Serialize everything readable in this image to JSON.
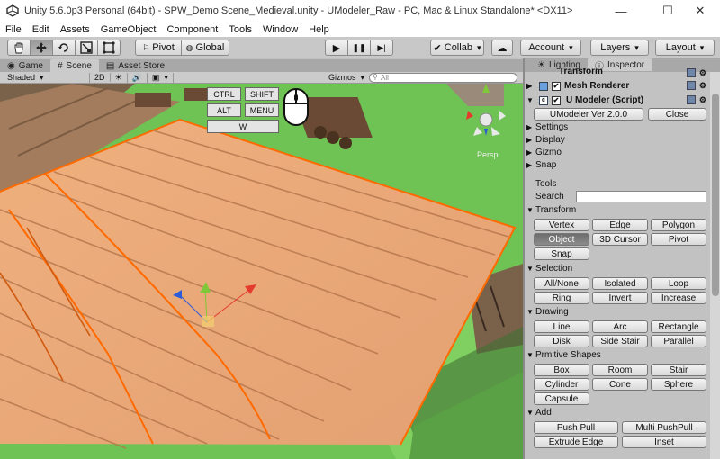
{
  "window": {
    "title": "Unity 5.6.0p3 Personal (64bit) - SPW_Demo Scene_Medieval.unity - UModeler_Raw - PC, Mac & Linux Standalone* <DX11>",
    "controls": [
      "—",
      "☐",
      "✕"
    ]
  },
  "menu": [
    "File",
    "Edit",
    "Assets",
    "GameObject",
    "Component",
    "Tools",
    "Window",
    "Help"
  ],
  "toolbar": {
    "tools": [
      "hand-icon",
      "move-icon",
      "rotate-icon",
      "scale-icon",
      "rect-icon"
    ],
    "pivot": "Pivot",
    "global": "Global",
    "play": [
      "▶",
      "❚❚",
      "▶|"
    ],
    "collab": "Collab",
    "account": "Account",
    "layers": "Layers",
    "layout": "Layout"
  },
  "tabs": {
    "game": "Game",
    "scene": "Scene",
    "asset_store": "Asset Store"
  },
  "scenebar": {
    "shading": "Shaded",
    "mode2d": "2D",
    "gizmos": "Gizmos",
    "search_placeholder": "All"
  },
  "overlay": {
    "keys": [
      "CTRL",
      "SHIFT",
      "ALT",
      "MENU",
      "W"
    ],
    "persp": "Persp"
  },
  "inspector": {
    "tabs": {
      "lighting": "Lighting",
      "inspector": "Inspector"
    },
    "components": [
      "Transform",
      "Mesh Renderer",
      "U Modeler (Script)"
    ],
    "version_button": "UModeler Ver 2.0.0",
    "close_button": "Close",
    "foldouts": [
      "Settings",
      "Display",
      "Gizmo",
      "Snap"
    ],
    "tools_label": "Tools",
    "search_label": "Search",
    "transform_label": "Transform",
    "transform_buttons": [
      "Vertex",
      "Edge",
      "Polygon",
      "Object",
      "3D Cursor",
      "Pivot",
      "Snap"
    ],
    "selection_label": "Selection",
    "selection_buttons": [
      "All/None",
      "Isolated",
      "Loop",
      "Ring",
      "Invert",
      "Increase"
    ],
    "drawing_label": "Drawing",
    "drawing_buttons": [
      "Line",
      "Arc",
      "Rectangle",
      "Disk",
      "Side Stair",
      "Parallel"
    ],
    "primitive_label": "Prmitive Shapes",
    "primitive_buttons": [
      "Box",
      "Room",
      "Stair",
      "Cylinder",
      "Cone",
      "Sphere",
      "Capsule"
    ],
    "add_label": "Add",
    "add_buttons": [
      "Push Pull",
      "Multi PushPull",
      "Extrude Edge",
      "Inset"
    ]
  },
  "colors": {
    "selection_outline": "#ff6a00",
    "deck": "#e0a070",
    "grass": "#74c858",
    "active_button": "#6d6d6d"
  }
}
